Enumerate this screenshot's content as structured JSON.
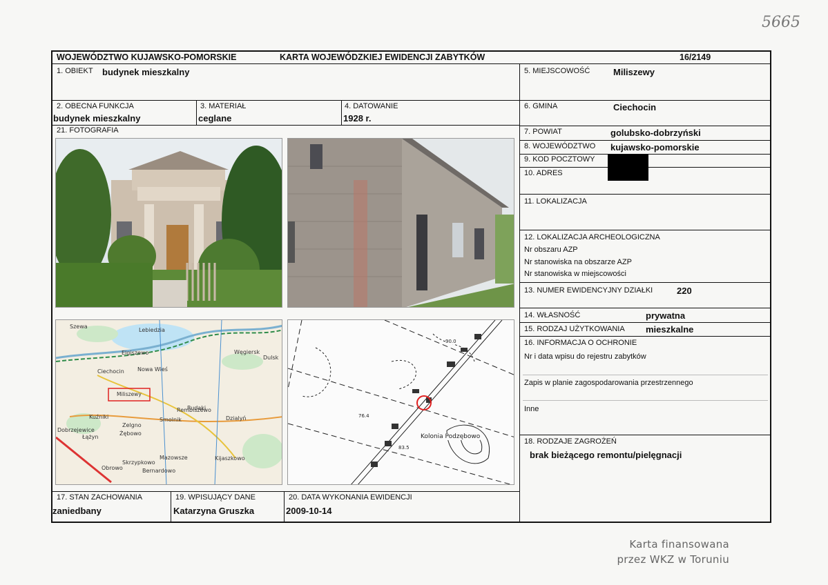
{
  "handwritten_number": "5665",
  "header": {
    "region": "WOJEWÓDZTWO KUJAWSKO-POMORSKIE",
    "title": "KARTA WOJEWÓDZKIEJ EWIDENCJI ZABYTKÓW",
    "number": "16/2149"
  },
  "f1": {
    "label": "1. OBIEKT",
    "value": "budynek mieszkalny"
  },
  "f2": {
    "label": "2. OBECNA FUNKCJA",
    "value": "budynek mieszkalny"
  },
  "f3": {
    "label": "3. MATERIAŁ",
    "value": "ceglane"
  },
  "f4": {
    "label": "4. DATOWANIE",
    "value": "1928 r."
  },
  "f5": {
    "label": "5. MIEJSCOWOŚĆ",
    "value": "Miliszewy"
  },
  "f6": {
    "label": "6. GMINA",
    "value": "Ciechocin"
  },
  "f7": {
    "label": "7. POWIAT",
    "value": "golubsko-dobrzyński"
  },
  "f8": {
    "label": "8. WOJEWÓDZTWO",
    "value": "kujawsko-pomorskie"
  },
  "f9": {
    "label": "9. KOD POCZTOWY"
  },
  "f10": {
    "label": "10. ADRES"
  },
  "f11": {
    "label": "11. LOKALIZACJA"
  },
  "f12": {
    "label": "12. LOKALIZACJA ARCHEOLOGICZNA",
    "line1": "Nr obszaru AZP",
    "line2": "Nr stanowiska na obszarze AZP",
    "line3": "Nr stanowiska w miejscowości"
  },
  "f13": {
    "label": "13. NUMER EWIDENCYJNY DZIAŁKI",
    "value": "220"
  },
  "f14": {
    "label": "14. WŁASNOŚĆ",
    "value": "prywatna"
  },
  "f15": {
    "label": "15. RODZAJ UŻYTKOWANIA",
    "value": "mieszkalne"
  },
  "f16": {
    "label": "16. INFORMACJA O OCHRONIE",
    "line1": "Nr i data wpisu do rejestru zabytków",
    "line2": "Zapis w planie zagospodarowania przestrzennego",
    "line3": "Inne"
  },
  "f17": {
    "label": "17. STAN ZACHOWANIA",
    "value": "zaniedbany"
  },
  "f18": {
    "label": "18. RODZAJE ZAGROŻEŃ",
    "value": "brak bieżącego remontu/pielęgnacji"
  },
  "f19": {
    "label": "19. WPISUJĄCY DANE",
    "value": "Katarzyna Gruszka"
  },
  "f20": {
    "label": "20. DATA WYKONANIA EWIDENCJI",
    "value": "2009-10-14"
  },
  "f21": {
    "label": "21. FOTOGRAFIA"
  },
  "map1": {
    "labels": [
      "Elgiszewo",
      "Ciechocin",
      "Nowa Wieś",
      "Miliszewy",
      "Węgiersk",
      "Dulsk",
      "Dobrzejewice",
      "Żębowo",
      "Rudaki",
      "Łążyn",
      "Obrowo",
      "Kuźniki",
      "Smolnik",
      "Rembiszewo",
      "Dzialyń",
      "Kijaszkowo",
      "Mazowsze",
      "Skrzypkowo",
      "Bernardowo",
      "Zelgno",
      "Szewa",
      "Lebiedzia"
    ],
    "highlight": "Miliszewy"
  },
  "map2": {
    "labels": [
      "Kolonia Podzębowo",
      "76.4",
      "83.5",
      "90.0"
    ]
  },
  "footer": {
    "line1": "Karta finansowana",
    "line2": "przez WKZ w Toruniu"
  },
  "colors": {
    "frame": "#111111",
    "redaction": "#000000",
    "map_highlight": "#e02020"
  }
}
